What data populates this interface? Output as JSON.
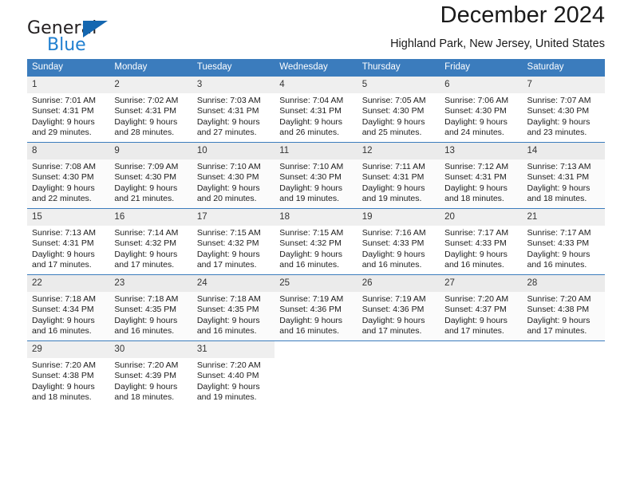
{
  "logo": {
    "word_top": "General",
    "word_bottom": "Blue",
    "triangle_color": "#1567b0",
    "blue_color": "#1f7fd0"
  },
  "header": {
    "title": "December 2024",
    "subtitle": "Highland Park, New Jersey, United States"
  },
  "colors": {
    "header_band": "#3b7cbd",
    "daynum_band": "#efefef",
    "alt_row": "#fbfbfb"
  },
  "weekday_headers": [
    "Sunday",
    "Monday",
    "Tuesday",
    "Wednesday",
    "Thursday",
    "Friday",
    "Saturday"
  ],
  "weeks": [
    [
      {
        "day": "1",
        "sunrise": "Sunrise: 7:01 AM",
        "sunset": "Sunset: 4:31 PM",
        "daylight1": "Daylight: 9 hours",
        "daylight2": "and 29 minutes."
      },
      {
        "day": "2",
        "sunrise": "Sunrise: 7:02 AM",
        "sunset": "Sunset: 4:31 PM",
        "daylight1": "Daylight: 9 hours",
        "daylight2": "and 28 minutes."
      },
      {
        "day": "3",
        "sunrise": "Sunrise: 7:03 AM",
        "sunset": "Sunset: 4:31 PM",
        "daylight1": "Daylight: 9 hours",
        "daylight2": "and 27 minutes."
      },
      {
        "day": "4",
        "sunrise": "Sunrise: 7:04 AM",
        "sunset": "Sunset: 4:31 PM",
        "daylight1": "Daylight: 9 hours",
        "daylight2": "and 26 minutes."
      },
      {
        "day": "5",
        "sunrise": "Sunrise: 7:05 AM",
        "sunset": "Sunset: 4:30 PM",
        "daylight1": "Daylight: 9 hours",
        "daylight2": "and 25 minutes."
      },
      {
        "day": "6",
        "sunrise": "Sunrise: 7:06 AM",
        "sunset": "Sunset: 4:30 PM",
        "daylight1": "Daylight: 9 hours",
        "daylight2": "and 24 minutes."
      },
      {
        "day": "7",
        "sunrise": "Sunrise: 7:07 AM",
        "sunset": "Sunset: 4:30 PM",
        "daylight1": "Daylight: 9 hours",
        "daylight2": "and 23 minutes."
      }
    ],
    [
      {
        "day": "8",
        "sunrise": "Sunrise: 7:08 AM",
        "sunset": "Sunset: 4:30 PM",
        "daylight1": "Daylight: 9 hours",
        "daylight2": "and 22 minutes."
      },
      {
        "day": "9",
        "sunrise": "Sunrise: 7:09 AM",
        "sunset": "Sunset: 4:30 PM",
        "daylight1": "Daylight: 9 hours",
        "daylight2": "and 21 minutes."
      },
      {
        "day": "10",
        "sunrise": "Sunrise: 7:10 AM",
        "sunset": "Sunset: 4:30 PM",
        "daylight1": "Daylight: 9 hours",
        "daylight2": "and 20 minutes."
      },
      {
        "day": "11",
        "sunrise": "Sunrise: 7:10 AM",
        "sunset": "Sunset: 4:30 PM",
        "daylight1": "Daylight: 9 hours",
        "daylight2": "and 19 minutes."
      },
      {
        "day": "12",
        "sunrise": "Sunrise: 7:11 AM",
        "sunset": "Sunset: 4:31 PM",
        "daylight1": "Daylight: 9 hours",
        "daylight2": "and 19 minutes."
      },
      {
        "day": "13",
        "sunrise": "Sunrise: 7:12 AM",
        "sunset": "Sunset: 4:31 PM",
        "daylight1": "Daylight: 9 hours",
        "daylight2": "and 18 minutes."
      },
      {
        "day": "14",
        "sunrise": "Sunrise: 7:13 AM",
        "sunset": "Sunset: 4:31 PM",
        "daylight1": "Daylight: 9 hours",
        "daylight2": "and 18 minutes."
      }
    ],
    [
      {
        "day": "15",
        "sunrise": "Sunrise: 7:13 AM",
        "sunset": "Sunset: 4:31 PM",
        "daylight1": "Daylight: 9 hours",
        "daylight2": "and 17 minutes."
      },
      {
        "day": "16",
        "sunrise": "Sunrise: 7:14 AM",
        "sunset": "Sunset: 4:32 PM",
        "daylight1": "Daylight: 9 hours",
        "daylight2": "and 17 minutes."
      },
      {
        "day": "17",
        "sunrise": "Sunrise: 7:15 AM",
        "sunset": "Sunset: 4:32 PM",
        "daylight1": "Daylight: 9 hours",
        "daylight2": "and 17 minutes."
      },
      {
        "day": "18",
        "sunrise": "Sunrise: 7:15 AM",
        "sunset": "Sunset: 4:32 PM",
        "daylight1": "Daylight: 9 hours",
        "daylight2": "and 16 minutes."
      },
      {
        "day": "19",
        "sunrise": "Sunrise: 7:16 AM",
        "sunset": "Sunset: 4:33 PM",
        "daylight1": "Daylight: 9 hours",
        "daylight2": "and 16 minutes."
      },
      {
        "day": "20",
        "sunrise": "Sunrise: 7:17 AM",
        "sunset": "Sunset: 4:33 PM",
        "daylight1": "Daylight: 9 hours",
        "daylight2": "and 16 minutes."
      },
      {
        "day": "21",
        "sunrise": "Sunrise: 7:17 AM",
        "sunset": "Sunset: 4:33 PM",
        "daylight1": "Daylight: 9 hours",
        "daylight2": "and 16 minutes."
      }
    ],
    [
      {
        "day": "22",
        "sunrise": "Sunrise: 7:18 AM",
        "sunset": "Sunset: 4:34 PM",
        "daylight1": "Daylight: 9 hours",
        "daylight2": "and 16 minutes."
      },
      {
        "day": "23",
        "sunrise": "Sunrise: 7:18 AM",
        "sunset": "Sunset: 4:35 PM",
        "daylight1": "Daylight: 9 hours",
        "daylight2": "and 16 minutes."
      },
      {
        "day": "24",
        "sunrise": "Sunrise: 7:18 AM",
        "sunset": "Sunset: 4:35 PM",
        "daylight1": "Daylight: 9 hours",
        "daylight2": "and 16 minutes."
      },
      {
        "day": "25",
        "sunrise": "Sunrise: 7:19 AM",
        "sunset": "Sunset: 4:36 PM",
        "daylight1": "Daylight: 9 hours",
        "daylight2": "and 16 minutes."
      },
      {
        "day": "26",
        "sunrise": "Sunrise: 7:19 AM",
        "sunset": "Sunset: 4:36 PM",
        "daylight1": "Daylight: 9 hours",
        "daylight2": "and 17 minutes."
      },
      {
        "day": "27",
        "sunrise": "Sunrise: 7:20 AM",
        "sunset": "Sunset: 4:37 PM",
        "daylight1": "Daylight: 9 hours",
        "daylight2": "and 17 minutes."
      },
      {
        "day": "28",
        "sunrise": "Sunrise: 7:20 AM",
        "sunset": "Sunset: 4:38 PM",
        "daylight1": "Daylight: 9 hours",
        "daylight2": "and 17 minutes."
      }
    ],
    [
      {
        "day": "29",
        "sunrise": "Sunrise: 7:20 AM",
        "sunset": "Sunset: 4:38 PM",
        "daylight1": "Daylight: 9 hours",
        "daylight2": "and 18 minutes."
      },
      {
        "day": "30",
        "sunrise": "Sunrise: 7:20 AM",
        "sunset": "Sunset: 4:39 PM",
        "daylight1": "Daylight: 9 hours",
        "daylight2": "and 18 minutes."
      },
      {
        "day": "31",
        "sunrise": "Sunrise: 7:20 AM",
        "sunset": "Sunset: 4:40 PM",
        "daylight1": "Daylight: 9 hours",
        "daylight2": "and 19 minutes."
      },
      {
        "day": "",
        "sunrise": "",
        "sunset": "",
        "daylight1": "",
        "daylight2": ""
      },
      {
        "day": "",
        "sunrise": "",
        "sunset": "",
        "daylight1": "",
        "daylight2": ""
      },
      {
        "day": "",
        "sunrise": "",
        "sunset": "",
        "daylight1": "",
        "daylight2": ""
      },
      {
        "day": "",
        "sunrise": "",
        "sunset": "",
        "daylight1": "",
        "daylight2": ""
      }
    ]
  ]
}
